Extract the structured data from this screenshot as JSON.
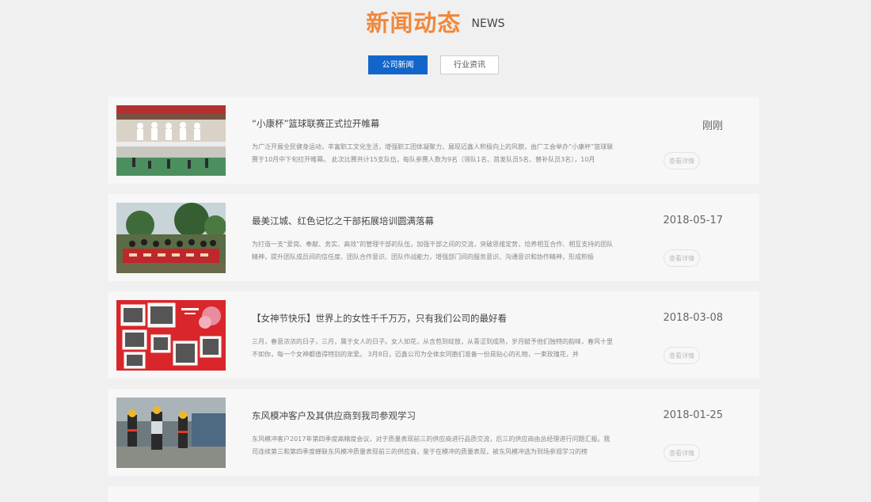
{
  "header": {
    "title_cn": "新闻动态",
    "title_en": "NEWS"
  },
  "tabs": [
    {
      "label": "公司新闻",
      "active": true
    },
    {
      "label": "行业资讯",
      "active": false
    }
  ],
  "news": [
    {
      "title": "“小康杯”篮球联赛正式拉开帷幕",
      "excerpt": "为广泛开展全民健身运动，丰富职工文化生活，增强职工团体凝聚力，展现迈鑫人积极向上的风貌，由厂工会举办“小康杯”篮球联赛于10月中下旬拉开帷幕。 此次比赛共计15支队伍，每队参赛人数为9名（领队1名、首发队员5名、替补队员3名），10月",
      "date": "刚刚",
      "detail_label": "查看详情"
    },
    {
      "title": "最美江城、红色记忆之干部拓展培训圆满落幕",
      "excerpt": "为打造一支“爱岗、奉献、务实、高效”的管理干部的队伍，加强干部之间的交流，突破思维定势，培养相互合作、相互支持的团队精神，提升团队成员间的信任度、团队合作意识、团队作战能力，增强部门间的服务意识、沟通意识和协作精神，形成积极",
      "date": "2018-05-17",
      "detail_label": "查看详情"
    },
    {
      "title": "【女神节快乐】世界上的女性千千万万，只有我们公司的最好看",
      "excerpt": "三月，春意浓浓的日子，三月，属于女人的日子。女人如花，从含苞到绽放，从青涩到成熟，岁月赋予他们独特的韵味，春风十里不如你，每一个女神都值得特别的宠爱。 3月8日，迈鑫公司为全体女同胞们准备一份晁贴心的礼物，一束玫瑰花，并",
      "date": "2018-03-08",
      "detail_label": "查看详情"
    },
    {
      "title": "东风模冲客户及其供应商到我司参观学习",
      "excerpt": "东风模冲客户2017年第四季度高精度会议，对于质量表现前三的供应商进行品质交流，后三的供应商由总经理进行问题汇报。我司连续第三和第四季度蝉联东风模冲质量表现前三的供应商，鉴于在模冲的质量表现，被东风模冲选为到场参观学习的榜",
      "date": "2018-01-25",
      "detail_label": "查看详情"
    }
  ]
}
